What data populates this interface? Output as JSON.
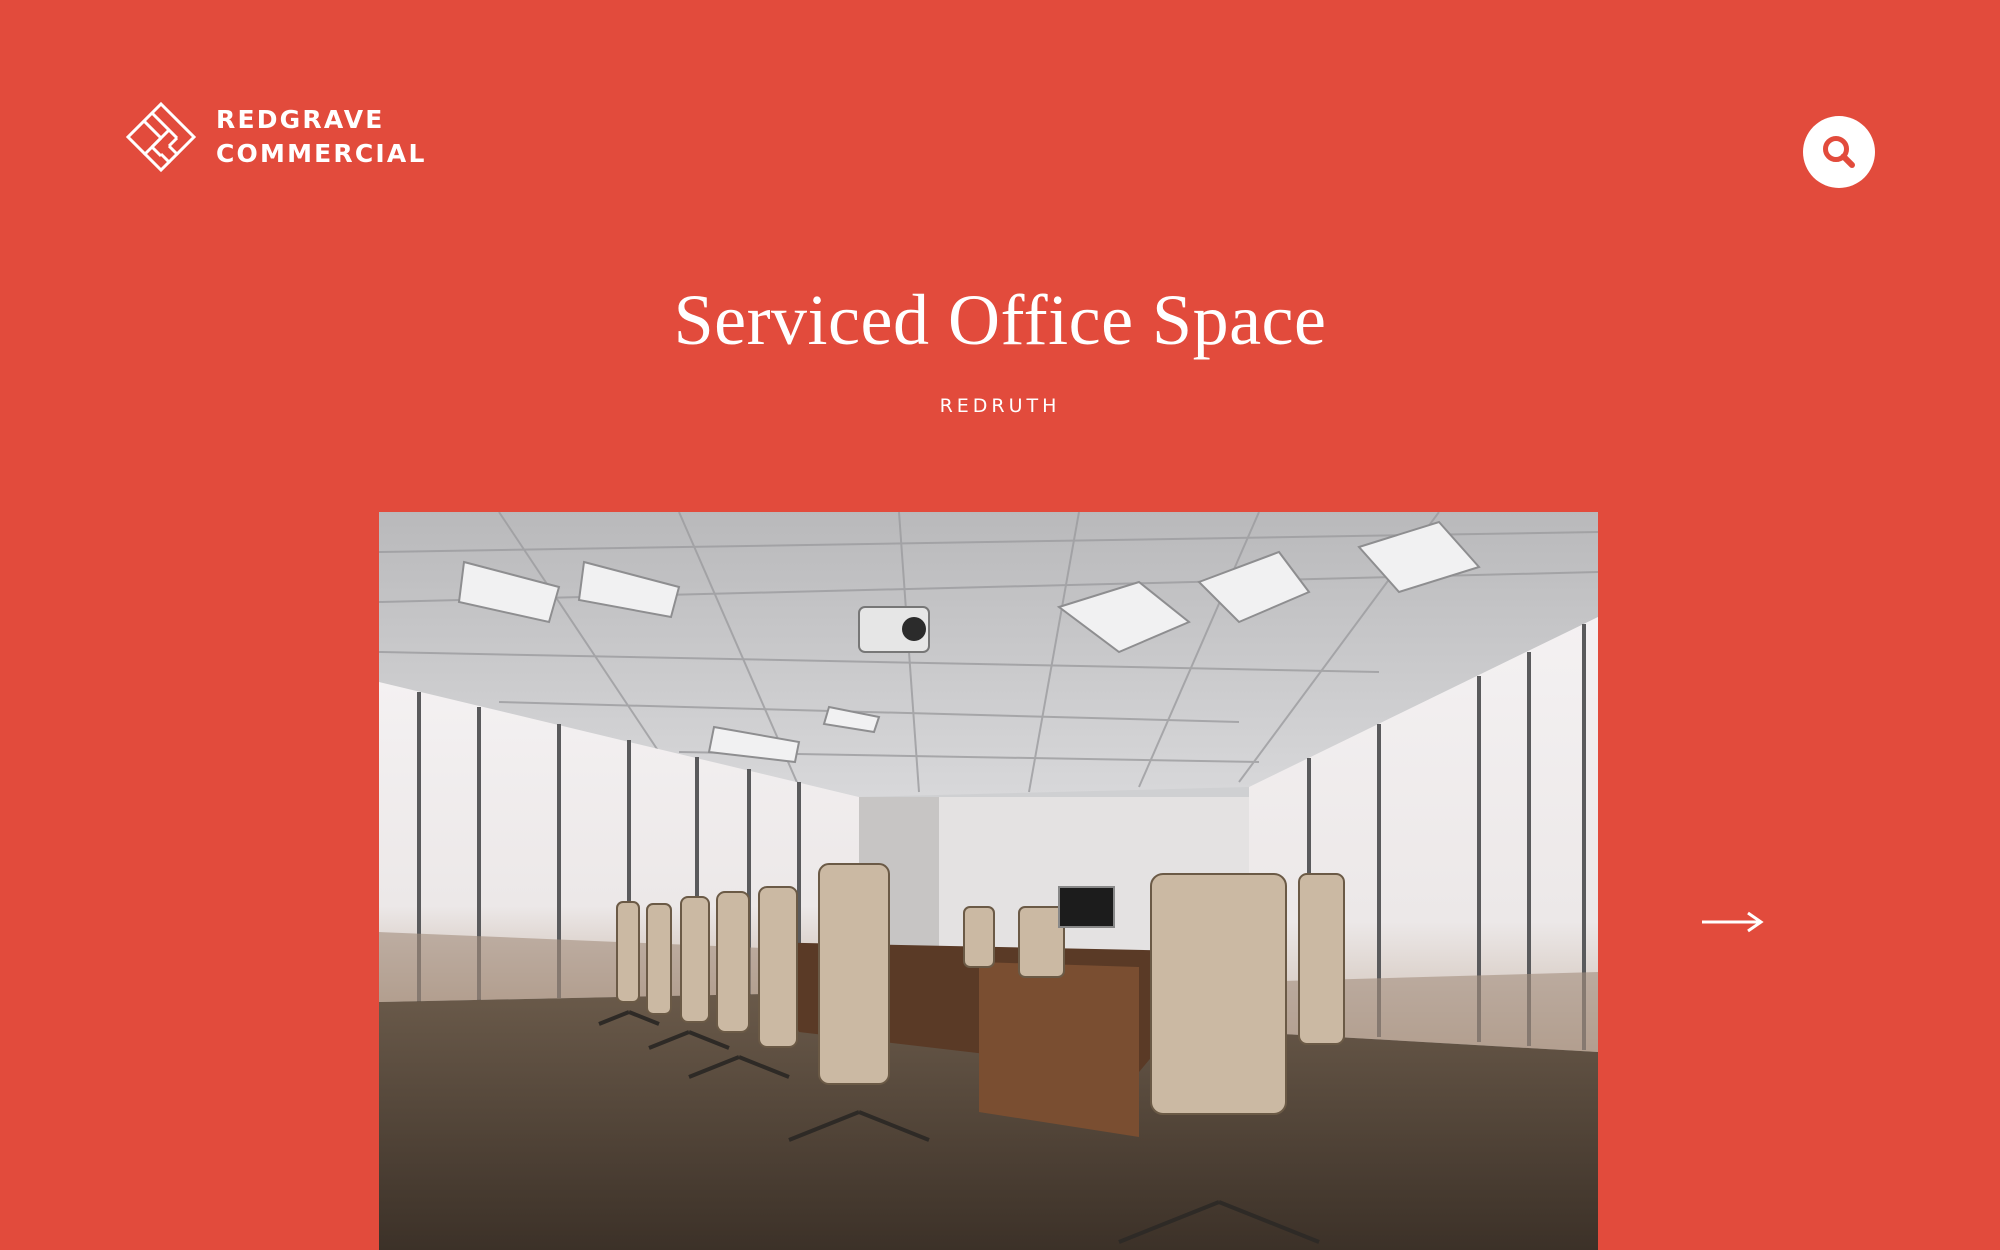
{
  "header": {
    "logo": {
      "line1": "REDGRAVE",
      "line2": "COMMERCIAL",
      "icon": "redgrave-logo-mark"
    },
    "search": {
      "icon": "search-icon"
    }
  },
  "listing": {
    "title": "Serviced Office Space",
    "location": "REDRUTH",
    "photo": "conference-room-photo"
  },
  "navigation": {
    "next_icon": "arrow-right-icon"
  },
  "colors": {
    "background": "#e24b3c",
    "foreground": "#ffffff"
  }
}
